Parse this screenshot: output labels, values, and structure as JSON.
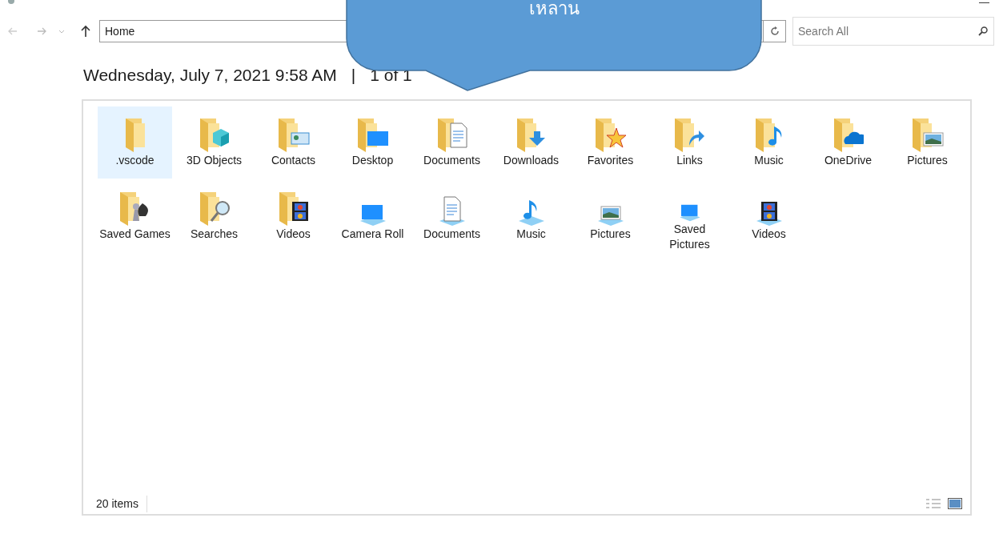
{
  "window": {
    "minimize": "—"
  },
  "toolbar": {
    "address": "Home",
    "search": {
      "placeholder": "Search All"
    }
  },
  "heading": {
    "date": "Wednesday, July 7, 2021 9:58 AM",
    "separator": "|",
    "page": "1 of 1"
  },
  "items": [
    {
      "label": ".vscode",
      "kind": "folder",
      "selected": true
    },
    {
      "label": "3D Objects",
      "kind": "folder",
      "selected": false
    },
    {
      "label": "Contacts",
      "kind": "folder",
      "selected": false
    },
    {
      "label": "Desktop",
      "kind": "folder",
      "selected": false
    },
    {
      "label": "Documents",
      "kind": "folder",
      "selected": false
    },
    {
      "label": "Downloads",
      "kind": "folder",
      "selected": false
    },
    {
      "label": "Favorites",
      "kind": "folder",
      "selected": false
    },
    {
      "label": "Links",
      "kind": "folder",
      "selected": false
    },
    {
      "label": "Music",
      "kind": "folder",
      "selected": false
    },
    {
      "label": "OneDrive",
      "kind": "folder",
      "selected": false
    },
    {
      "label": "Pictures",
      "kind": "folder",
      "selected": false
    },
    {
      "label": "Saved Games",
      "kind": "folder",
      "selected": false
    },
    {
      "label": "Searches",
      "kind": "folder",
      "selected": false
    },
    {
      "label": "Videos",
      "kind": "folder",
      "selected": false
    },
    {
      "label": "Camera Roll",
      "kind": "library",
      "selected": false
    },
    {
      "label": "Documents",
      "kind": "library",
      "selected": false
    },
    {
      "label": "Music",
      "kind": "library",
      "selected": false
    },
    {
      "label": "Pictures",
      "kind": "library",
      "selected": false
    },
    {
      "label": "Saved Pictures",
      "kind": "library",
      "selected": false
    },
    {
      "label": "Videos",
      "kind": "library",
      "selected": false
    }
  ],
  "status_bar": {
    "count": "20 items"
  },
  "callout": {
    "text": "เหลาน"
  }
}
